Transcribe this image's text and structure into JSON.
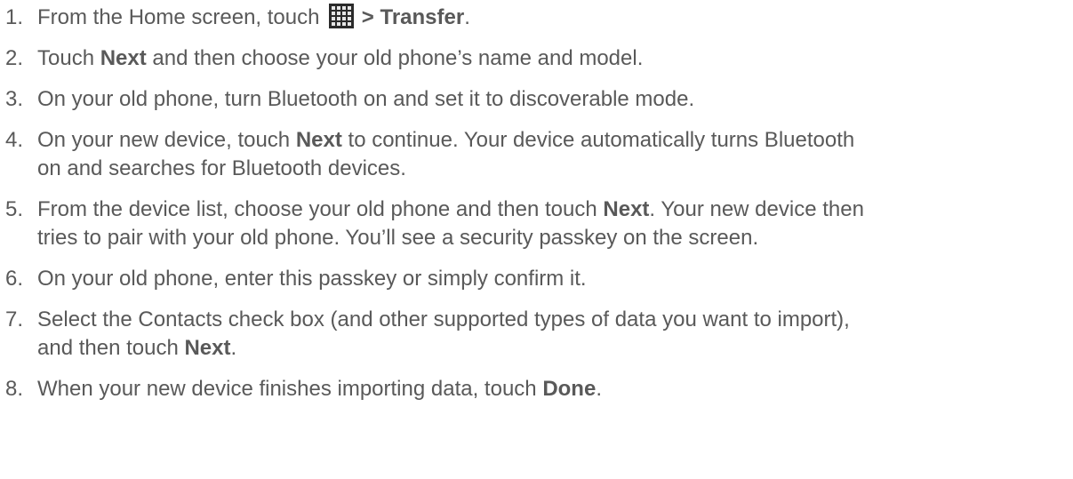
{
  "steps": [
    {
      "number": "1.",
      "parts": {
        "a": "From the Home screen, touch ",
        "b": " > Transfer",
        "c": "."
      },
      "icon": "apps-grid-icon"
    },
    {
      "number": "2.",
      "parts": {
        "a": "Touch ",
        "b": "Next",
        "c": " and then choose your old phone’s name and model."
      }
    },
    {
      "number": "3.",
      "parts": {
        "a": "On your old phone, turn Bluetooth on and set it to discoverable mode."
      }
    },
    {
      "number": "4.",
      "lines": {
        "l1a": "On your new device, touch ",
        "l1b": "Next",
        "l1c": " to continue. Your device automatically turns Bluetooth",
        "l2": "on and searches for Bluetooth devices."
      }
    },
    {
      "number": "5.",
      "lines": {
        "l1a": "From the device list, choose your old phone and then touch ",
        "l1b": "Next",
        "l1c": ". Your new device then",
        "l2": "tries to pair with your old phone. You’ll see a security passkey on the screen."
      }
    },
    {
      "number": "6.",
      "parts": {
        "a": "On your old phone, enter this passkey or simply confirm it."
      }
    },
    {
      "number": "7.",
      "lines": {
        "l1": "Select the Contacts check box (and other supported types of data you want to import),",
        "l2a": "and then touch ",
        "l2b": "Next",
        "l2c": "."
      }
    },
    {
      "number": "8.",
      "parts": {
        "a": "When your new device finishes importing data, touch ",
        "b": "Done",
        "c": "."
      }
    }
  ],
  "colors": {
    "text": "#595959",
    "icon_bg": "#2b2b2b",
    "icon_cells": "#e6e6e6"
  }
}
